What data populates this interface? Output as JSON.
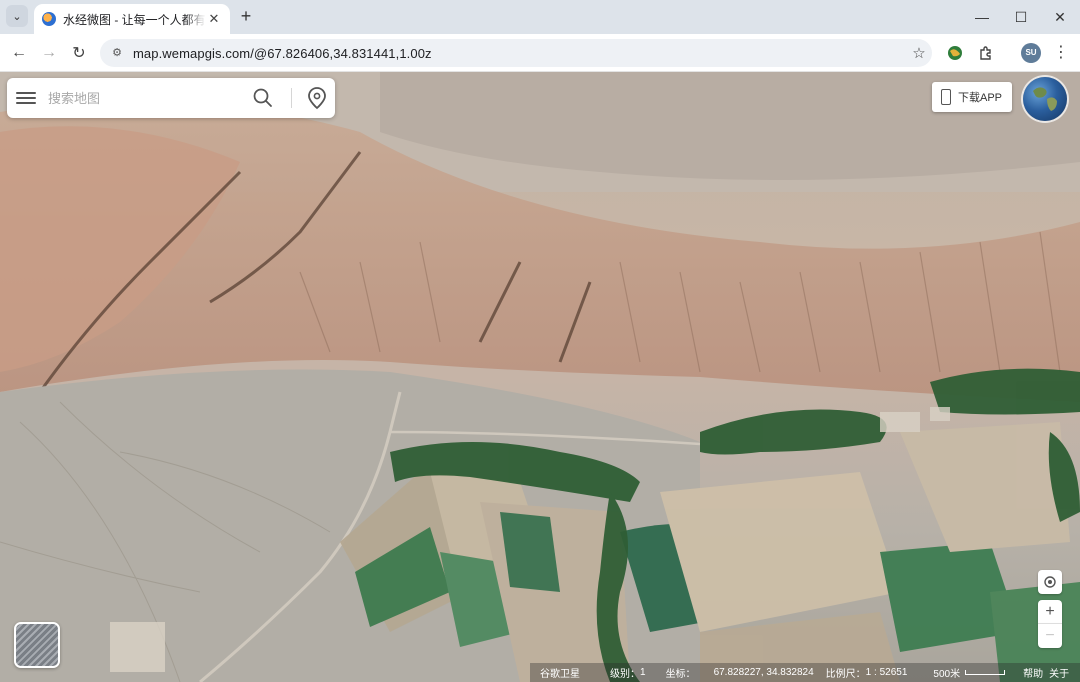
{
  "browser": {
    "tab_title": "水经微图 - 让每一个人都有自己的地图",
    "url": "map.wemapgis.com/@67.826406,34.831441,1.00z",
    "profile_initials": "SU"
  },
  "search": {
    "placeholder": "搜索地图"
  },
  "app_button": {
    "label": "下载APP"
  },
  "status": {
    "layer": "谷歌卫星",
    "level_label": "级别：",
    "level_value": "1",
    "coord_label": "坐标：",
    "coord_value": "67.828227, 34.832824",
    "scale_label": "比例尺：",
    "scale_value": "1 : 52651",
    "distance": "500米",
    "help": "帮助",
    "about": "关于"
  },
  "icons": {
    "tab_favicon": "wemap-logo",
    "search": "search-icon",
    "location": "map-pin-icon",
    "locate": "locate-icon",
    "zoom_in": "plus-icon",
    "zoom_out": "minus-icon"
  }
}
